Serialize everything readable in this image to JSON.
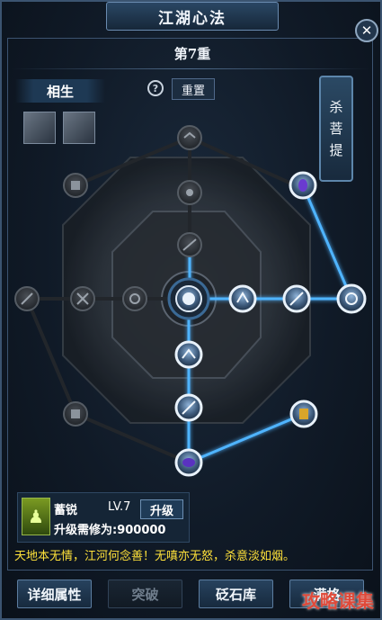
{
  "window": {
    "title": "江湖心法",
    "close_glyph": "✕"
  },
  "layer": {
    "title": "第7重"
  },
  "tabs": {
    "sheng": "相生"
  },
  "reset": {
    "label": "重置",
    "help_glyph": "?"
  },
  "side_tab": {
    "chars": [
      "杀",
      "菩",
      "提"
    ]
  },
  "selected_skill": {
    "name": "蓄锐",
    "level": "LV.7",
    "upgrade_label": "升级",
    "cost": "升级需修为:900000"
  },
  "quote": "天地本无情，江河何念善！无嗔亦无怒，杀意淡如烟。",
  "buttons": {
    "detail": "详细属性",
    "breakthrough": "突破",
    "whetstone": "砭石库",
    "max": "满格"
  },
  "watermark": "攻略课集",
  "colors": {
    "active_line": "#4fb4ff",
    "inactive_line": "#2a2f36",
    "quote": "#ffe23a"
  }
}
